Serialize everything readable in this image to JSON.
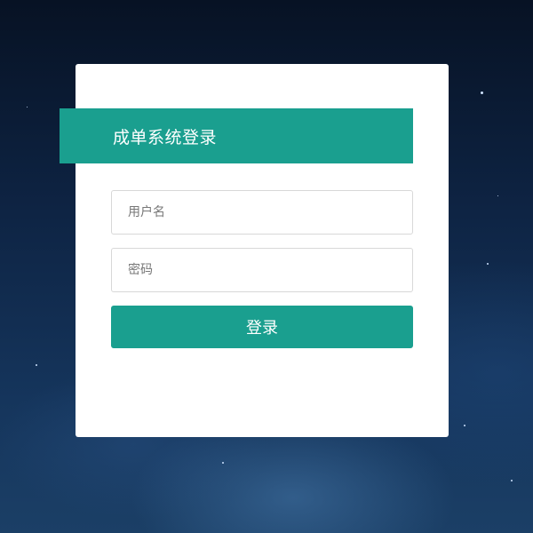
{
  "login": {
    "title": "成单系统登录",
    "username_placeholder": "用户名",
    "password_placeholder": "密码",
    "submit_label": "登录"
  },
  "colors": {
    "accent": "#1a9f8f",
    "card": "#ffffff",
    "background": "#0e2444"
  }
}
